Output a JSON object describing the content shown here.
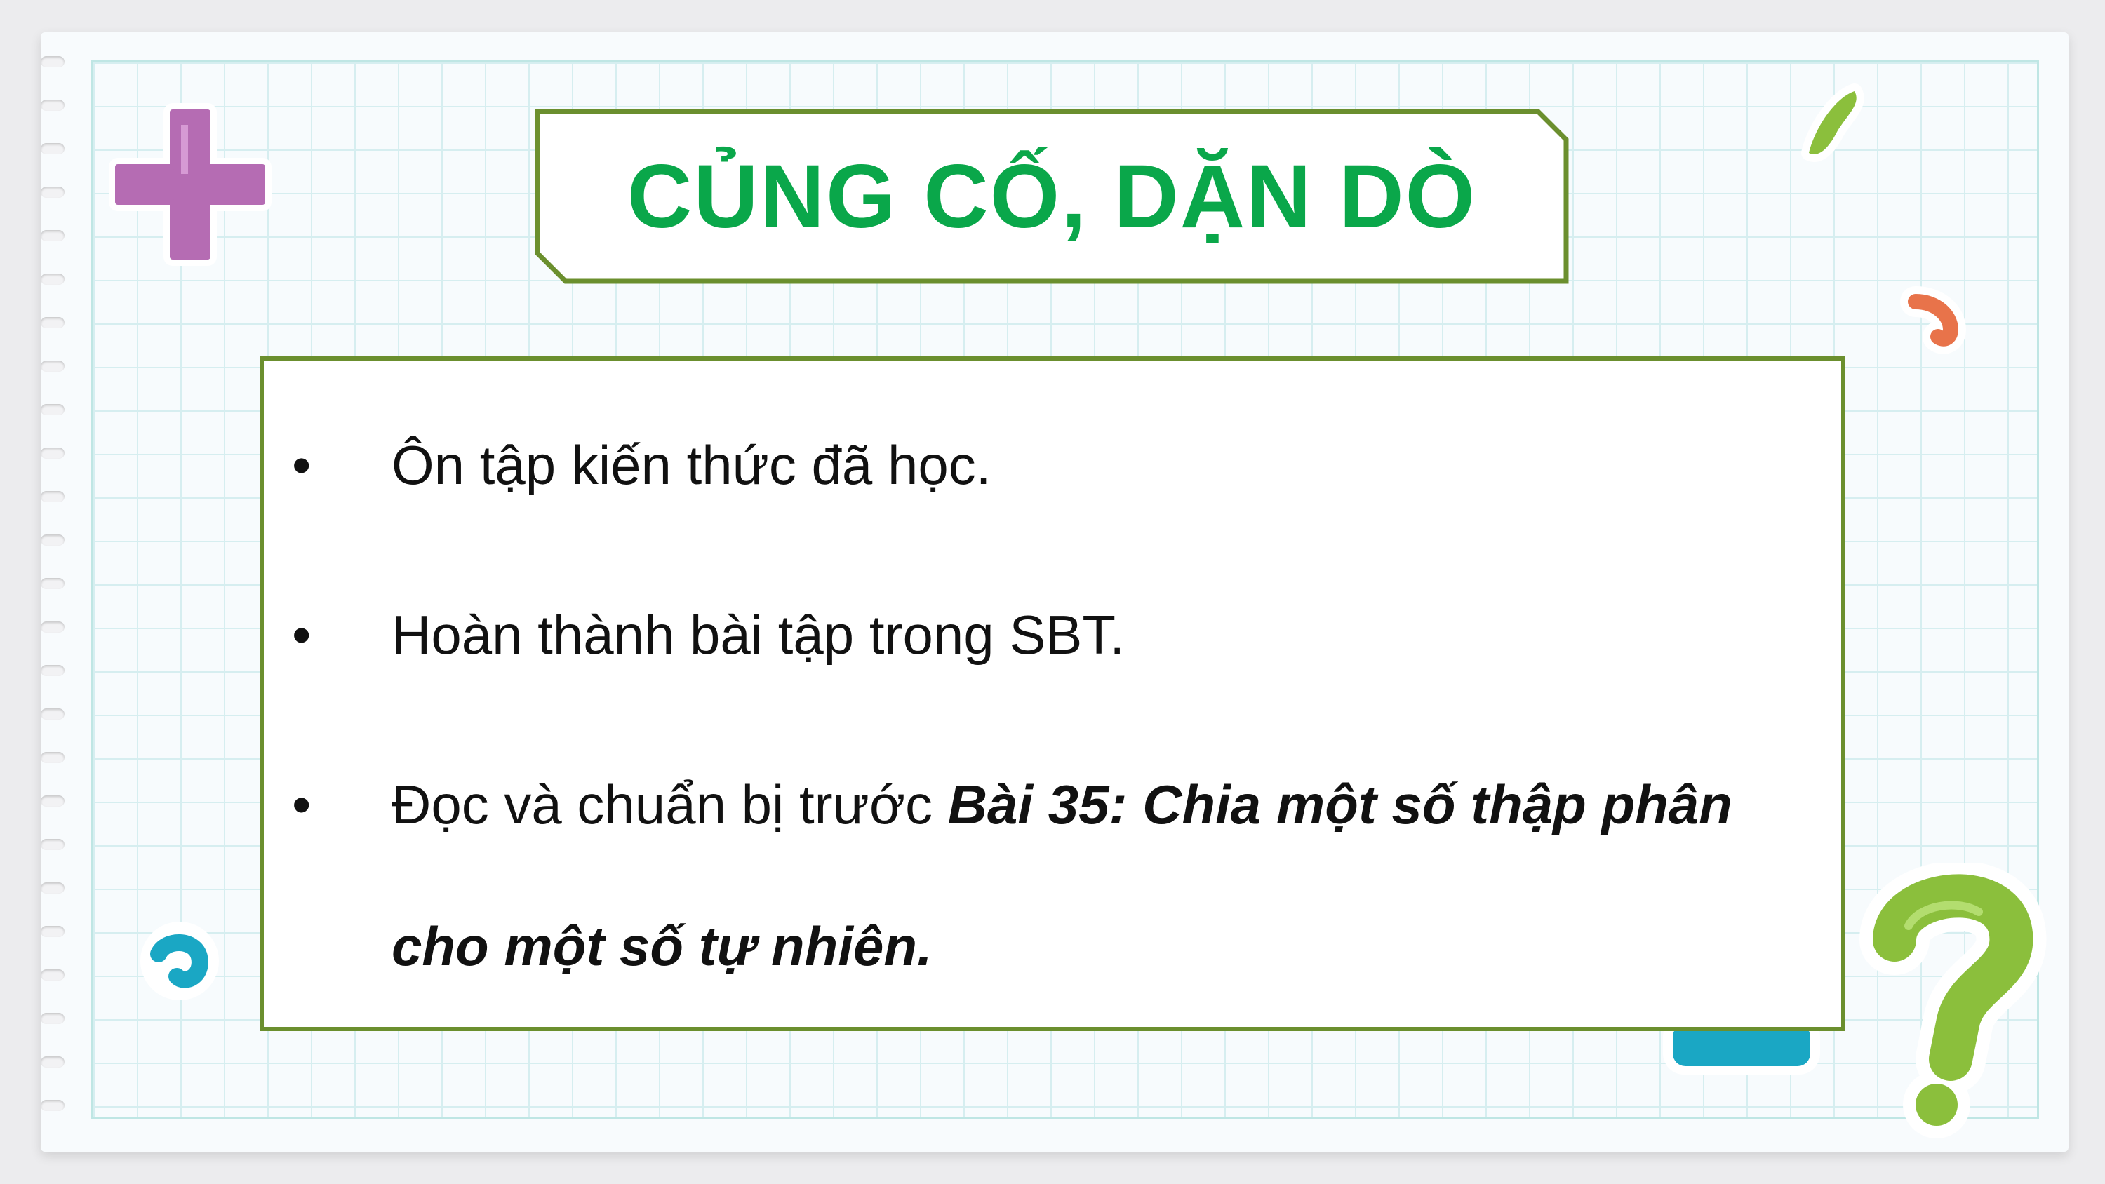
{
  "slide": {
    "title": "CỦNG CỐ, DẶN DÒ",
    "bullets": [
      {
        "text": "Ôn tập kiến thức đã học."
      },
      {
        "text": "Hoàn thành bài tập trong SBT."
      },
      {
        "text_plain": "Đọc và chuẩn bị trước ",
        "text_emphasis_line1": "Bài 35: Chia một số thập phân",
        "text_emphasis_line2": "cho một số tự nhiên."
      }
    ],
    "bullet_symbol": "•"
  },
  "colors": {
    "title_green": "#0aa74a",
    "border_olive": "#6b8f2e",
    "grid_line": "#d6eef0",
    "plus_purple": "#b56cb3",
    "question_green": "#8bbf3c",
    "accent_orange": "#e8734a",
    "accent_teal": "#1aa7c4"
  },
  "decorations": [
    "plus-icon",
    "question-mark-icon",
    "minus-icon",
    "leaf-icon",
    "swirl-icon",
    "hook-icon"
  ]
}
